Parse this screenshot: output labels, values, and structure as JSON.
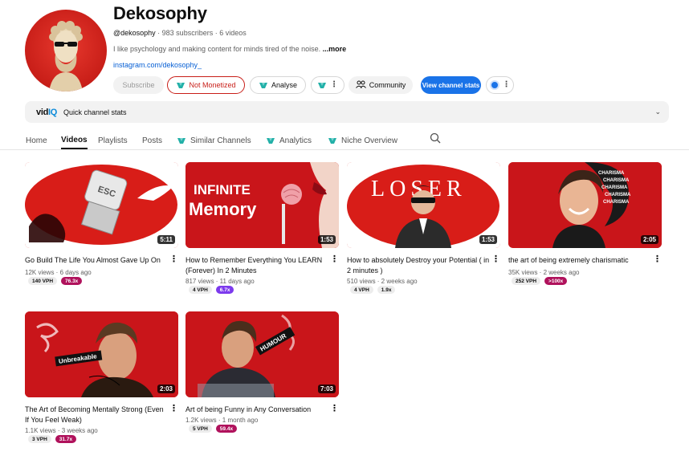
{
  "channel": {
    "name": "Dekosophy",
    "handle": "@dekosophy",
    "stats": " · 983 subscribers · 6 videos",
    "description": "I like psychology and making content for minds tired of the noise. ",
    "description_more": "...more",
    "link": "instagram.com/dekosophy_"
  },
  "buttons": {
    "subscribe": "Subscribe",
    "not_monetized": "Not Monetized",
    "analyse": "Analyse",
    "community": "Community",
    "view_channel_stats": "View channel stats"
  },
  "vidiq_bar": {
    "logo_a": "vid",
    "logo_b": "IQ",
    "label": "Quick channel stats"
  },
  "tabs": [
    {
      "label": "Home"
    },
    {
      "label": "Videos",
      "active": true
    },
    {
      "label": "Playlists"
    },
    {
      "label": "Posts"
    },
    {
      "label": "Similar Channels"
    },
    {
      "label": "Analytics"
    },
    {
      "label": "Niche Overview"
    }
  ],
  "videos": [
    {
      "title": "Go Build The Life You Almost Gave Up On",
      "views": "12K views · 6 days ago",
      "duration": "5:11",
      "vph": "140 VPH",
      "multiplier": "76.3x",
      "mult_color": "#b0125c",
      "thumb_text": "ESC"
    },
    {
      "title": "How to Remember Everything You LEARN (Forever) In 2 Minutes",
      "views": "817 views · 11 days ago",
      "duration": "1:53",
      "vph": "4 VPH",
      "multiplier": "6.7x",
      "mult_color": "#7c3aed",
      "thumb_text_1": "INFINITE",
      "thumb_text_2": "Memory"
    },
    {
      "title": "How to absolutely Destroy your Potential ( in 2 minutes )",
      "views": "510 views · 2 weeks ago",
      "duration": "1:53",
      "vph": "4 VPH",
      "multiplier": "1.9x",
      "mult_color": "#ececec",
      "thumb_text": "LOSER"
    },
    {
      "title": "the art of being extremely charismatic",
      "views": "35K views · 2 weeks ago",
      "duration": "2:05",
      "vph": "252 VPH",
      "multiplier": ">100x",
      "mult_color": "#b0125c",
      "thumb_text": "CHARISMA"
    },
    {
      "title": "The Art of Becoming Mentally Strong (Even If You Feel Weak)",
      "views": "1.1K views · 3 weeks ago",
      "duration": "2:03",
      "vph": "3 VPH",
      "multiplier": "31.7x",
      "mult_color": "#b0125c",
      "thumb_text": "Unbreakable"
    },
    {
      "title": "Art of being Funny in Any Conversation",
      "views": "1.2K views · 1 month ago",
      "duration": "7:03",
      "vph": "5 VPH",
      "multiplier": "59.4x",
      "mult_color": "#b0125c",
      "thumb_text": "HUMOUR"
    }
  ]
}
